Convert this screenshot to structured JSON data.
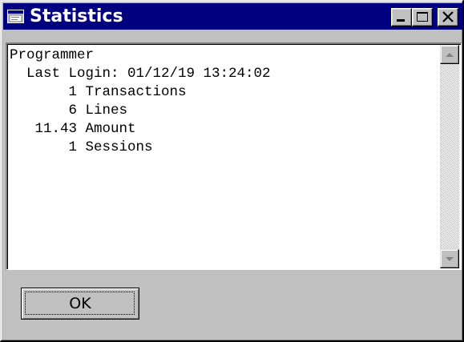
{
  "window": {
    "title": "Statistics",
    "title_bar_color": "#000080",
    "face_color": "#c0c0c0"
  },
  "titlebar_buttons": {
    "minimize": "minimize-icon",
    "maximize": "maximize-icon",
    "close": "close-icon"
  },
  "report": {
    "lines": [
      "Programmer",
      "  Last Login: 01/12/19 13:24:02",
      "       1 Transactions",
      "       6 Lines",
      "   11.43 Amount",
      "       1 Sessions"
    ]
  },
  "scrollbar": {
    "up_icon": "scroll-up-arrow-icon",
    "down_icon": "scroll-down-arrow-icon"
  },
  "buttons": {
    "ok_label": "OK"
  }
}
